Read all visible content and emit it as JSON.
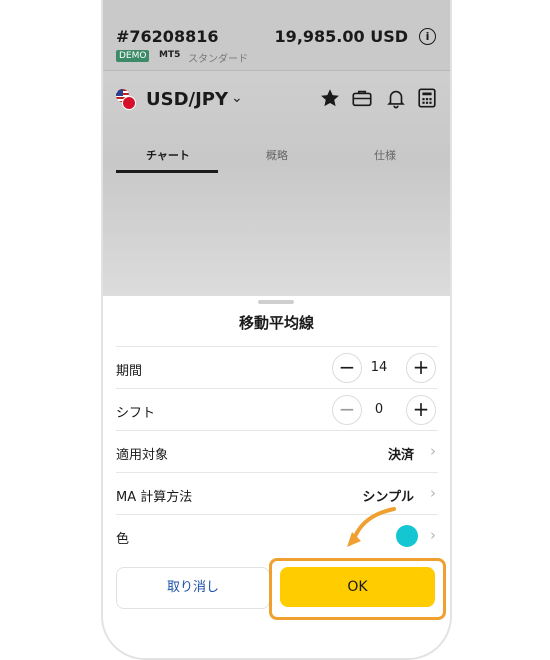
{
  "account": {
    "id": "#76208816",
    "balance": "19,985.00 USD",
    "badge_demo": "DEMO",
    "badge_platform": "MT5",
    "account_type": "スタンダード"
  },
  "instrument": {
    "symbol": "USD/JPY"
  },
  "tabs": [
    {
      "label": "チャート",
      "active": true
    },
    {
      "label": "概略",
      "active": false
    },
    {
      "label": "仕様",
      "active": false
    }
  ],
  "sheet": {
    "title": "移動平均線",
    "period": {
      "label": "期間",
      "value": "14"
    },
    "shift": {
      "label": "シフト",
      "value": "0"
    },
    "apply_to": {
      "label": "適用対象",
      "value": "決済"
    },
    "ma_method": {
      "label": "MA 計算方法",
      "value": "シンプル"
    },
    "color": {
      "label": "色",
      "swatch": "#13c6d2"
    },
    "cancel_label": "取り消し",
    "ok_label": "OK"
  },
  "colors": {
    "accent": "#ffcc00",
    "highlight": "#f0a030",
    "demo_badge": "#3c8a67"
  }
}
